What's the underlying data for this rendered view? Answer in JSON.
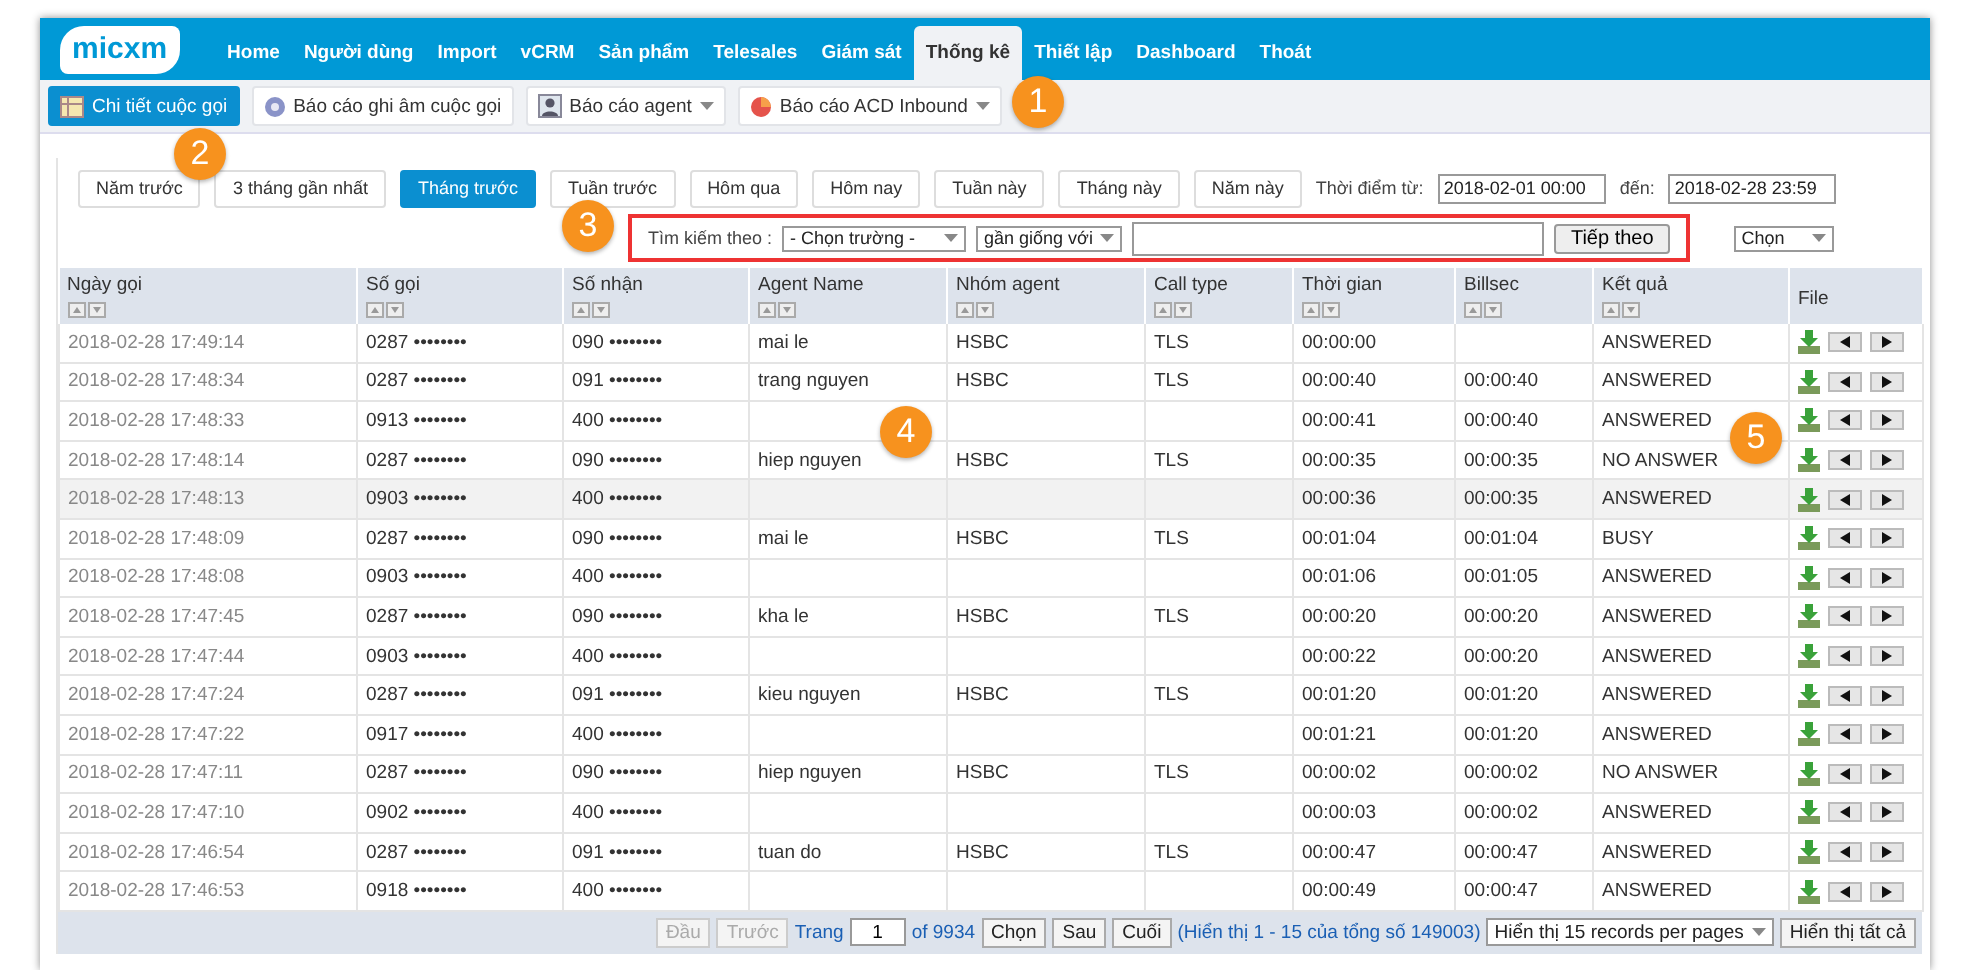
{
  "nav": {
    "logo": "micxm",
    "items": [
      {
        "label": "Home",
        "selected": false
      },
      {
        "label": "Người dùng",
        "selected": false
      },
      {
        "label": "Import",
        "selected": false
      },
      {
        "label": "vCRM",
        "selected": false
      },
      {
        "label": "Sản phẩm",
        "selected": false
      },
      {
        "label": "Telesales",
        "selected": false
      },
      {
        "label": "Giám sát",
        "selected": false
      },
      {
        "label": "Thống kê",
        "selected": true
      },
      {
        "label": "Thiết lập",
        "selected": false
      },
      {
        "label": "Dashboard",
        "selected": false
      },
      {
        "label": "Thoát",
        "selected": false
      }
    ]
  },
  "subnav": [
    {
      "label": "Chi tiết cuộc gọi",
      "selected": true,
      "has_menu": false
    },
    {
      "label": "Báo cáo ghi âm cuộc gọi",
      "selected": false,
      "has_menu": false
    },
    {
      "label": "Báo cáo agent",
      "selected": false,
      "has_menu": true
    },
    {
      "label": "Báo cáo ACD Inbound",
      "selected": false,
      "has_menu": true
    }
  ],
  "periods": [
    {
      "label": "Năm trước",
      "selected": false
    },
    {
      "label": "3 tháng gần nhất",
      "selected": false
    },
    {
      "label": "Tháng trước",
      "selected": true
    },
    {
      "label": "Tuần trước",
      "selected": false
    },
    {
      "label": "Hôm qua",
      "selected": false
    },
    {
      "label": "Hôm nay",
      "selected": false
    },
    {
      "label": "Tuần này",
      "selected": false
    },
    {
      "label": "Tháng này",
      "selected": false
    },
    {
      "label": "Năm này",
      "selected": false
    }
  ],
  "date_range": {
    "from_label": "Thời điểm từ:",
    "from": "2018-02-01 00:00",
    "to_label": "đến:",
    "to": "2018-02-28 23:59"
  },
  "search": {
    "label": "Tìm kiếm theo :",
    "field": "- Chọn trường -",
    "operator": "gần giống với",
    "button": "Tiếp theo"
  },
  "column_select": "Chọn",
  "table": {
    "columns": [
      {
        "label": "Ngày gọi",
        "sortable": true
      },
      {
        "label": "Số gọi",
        "sortable": true
      },
      {
        "label": "Số nhận",
        "sortable": true
      },
      {
        "label": "Agent Name",
        "sortable": true
      },
      {
        "label": "Nhóm agent",
        "sortable": true
      },
      {
        "label": "Call type",
        "sortable": true
      },
      {
        "label": "Thời gian",
        "sortable": true
      },
      {
        "label": "Billsec",
        "sortable": true
      },
      {
        "label": "Kết quả",
        "sortable": true
      },
      {
        "label": "File",
        "sortable": false
      }
    ],
    "rows": [
      {
        "selected": false,
        "cells": [
          "2018-02-28 17:49:14",
          "0287 ••••••••",
          "090 ••••••••",
          "mai le",
          "HSBC",
          "TLS",
          "00:00:00",
          "",
          "ANSWERED"
        ]
      },
      {
        "selected": false,
        "cells": [
          "2018-02-28 17:48:34",
          "0287 ••••••••",
          "091 ••••••••",
          "trang nguyen",
          "HSBC",
          "TLS",
          "00:00:40",
          "00:00:40",
          "ANSWERED"
        ]
      },
      {
        "selected": false,
        "cells": [
          "2018-02-28 17:48:33",
          "0913 ••••••••",
          "400 ••••••••",
          "",
          "",
          "",
          "00:00:41",
          "00:00:40",
          "ANSWERED"
        ]
      },
      {
        "selected": false,
        "cells": [
          "2018-02-28 17:48:14",
          "0287 ••••••••",
          "090 ••••••••",
          "hiep nguyen",
          "HSBC",
          "TLS",
          "00:00:35",
          "00:00:35",
          "NO ANSWER"
        ]
      },
      {
        "selected": true,
        "cells": [
          "2018-02-28 17:48:13",
          "0903 ••••••••",
          "400 ••••••••",
          "",
          "",
          "",
          "00:00:36",
          "00:00:35",
          "ANSWERED"
        ]
      },
      {
        "selected": false,
        "cells": [
          "2018-02-28 17:48:09",
          "0287 ••••••••",
          "090 ••••••••",
          "mai le",
          "HSBC",
          "TLS",
          "00:01:04",
          "00:01:04",
          "BUSY"
        ]
      },
      {
        "selected": false,
        "cells": [
          "2018-02-28 17:48:08",
          "0903 ••••••••",
          "400 ••••••••",
          "",
          "",
          "",
          "00:01:06",
          "00:01:05",
          "ANSWERED"
        ]
      },
      {
        "selected": false,
        "cells": [
          "2018-02-28 17:47:45",
          "0287 ••••••••",
          "090 ••••••••",
          "kha le",
          "HSBC",
          "TLS",
          "00:00:20",
          "00:00:20",
          "ANSWERED"
        ]
      },
      {
        "selected": false,
        "cells": [
          "2018-02-28 17:47:44",
          "0903 ••••••••",
          "400 ••••••••",
          "",
          "",
          "",
          "00:00:22",
          "00:00:20",
          "ANSWERED"
        ]
      },
      {
        "selected": false,
        "cells": [
          "2018-02-28 17:47:24",
          "0287 ••••••••",
          "091 ••••••••",
          "kieu nguyen",
          "HSBC",
          "TLS",
          "00:01:20",
          "00:01:20",
          "ANSWERED"
        ]
      },
      {
        "selected": false,
        "cells": [
          "2018-02-28 17:47:22",
          "0917 ••••••••",
          "400 ••••••••",
          "",
          "",
          "",
          "00:01:21",
          "00:01:20",
          "ANSWERED"
        ]
      },
      {
        "selected": false,
        "cells": [
          "2018-02-28 17:47:11",
          "0287 ••••••••",
          "090 ••••••••",
          "hiep nguyen",
          "HSBC",
          "TLS",
          "00:00:02",
          "00:00:02",
          "NO ANSWER"
        ]
      },
      {
        "selected": false,
        "cells": [
          "2018-02-28 17:47:10",
          "0902 ••••••••",
          "400 ••••••••",
          "",
          "",
          "",
          "00:00:03",
          "00:00:02",
          "ANSWERED"
        ]
      },
      {
        "selected": false,
        "cells": [
          "2018-02-28 17:46:54",
          "0287 ••••••••",
          "091 ••••••••",
          "tuan do",
          "HSBC",
          "TLS",
          "00:00:47",
          "00:00:47",
          "ANSWERED"
        ]
      },
      {
        "selected": false,
        "cells": [
          "2018-02-28 17:46:53",
          "0918 ••••••••",
          "400 ••••••••",
          "",
          "",
          "",
          "00:00:49",
          "00:00:47",
          "ANSWERED"
        ]
      }
    ]
  },
  "pager": {
    "first": {
      "label": "Đầu",
      "disabled": true
    },
    "prev": {
      "label": "Trước",
      "disabled": true
    },
    "page_label": "Trang",
    "page": "1",
    "of": "of 9934",
    "go": "Chọn",
    "next": {
      "label": "Sau",
      "disabled": false
    },
    "last": {
      "label": "Cuối",
      "disabled": false
    },
    "info": "(Hiển thị 1 - 15 của tổng số 149003)",
    "per_page": "Hiển thị 15 records per pages",
    "show_all": "Hiển thị tất cả"
  },
  "callouts": [
    "1",
    "2",
    "3",
    "4",
    "5"
  ]
}
